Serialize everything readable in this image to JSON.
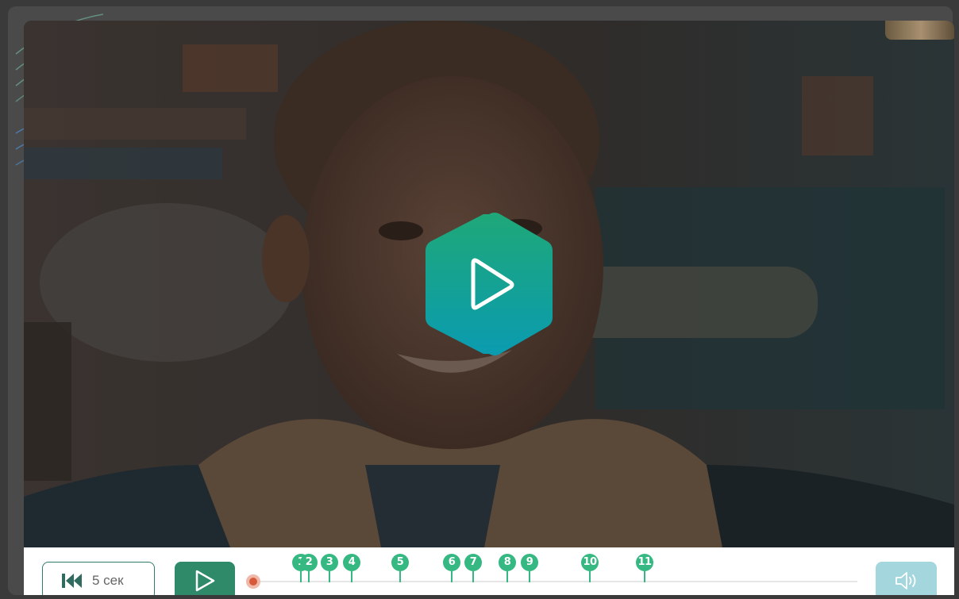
{
  "player": {
    "rewind_label": "5 сек",
    "rewind_icon": "skip-back-icon",
    "play_icon": "play-icon",
    "volume_icon": "speaker-icon",
    "big_play_icon": "play-icon",
    "accent_color": "#2f8a6a",
    "marker_color": "#36b882",
    "handle_color": "#d65a3a",
    "big_play_gradient": [
      "#1fa878",
      "#0a9bb0"
    ]
  },
  "timeline": {
    "progress": 0,
    "markers": [
      {
        "label": "1"
      },
      {
        "label": "2"
      },
      {
        "label": "3"
      },
      {
        "label": "4"
      },
      {
        "label": "5"
      },
      {
        "label": "6"
      },
      {
        "label": "7"
      },
      {
        "label": "8"
      },
      {
        "label": "9"
      },
      {
        "label": "10"
      },
      {
        "label": "11"
      }
    ]
  }
}
